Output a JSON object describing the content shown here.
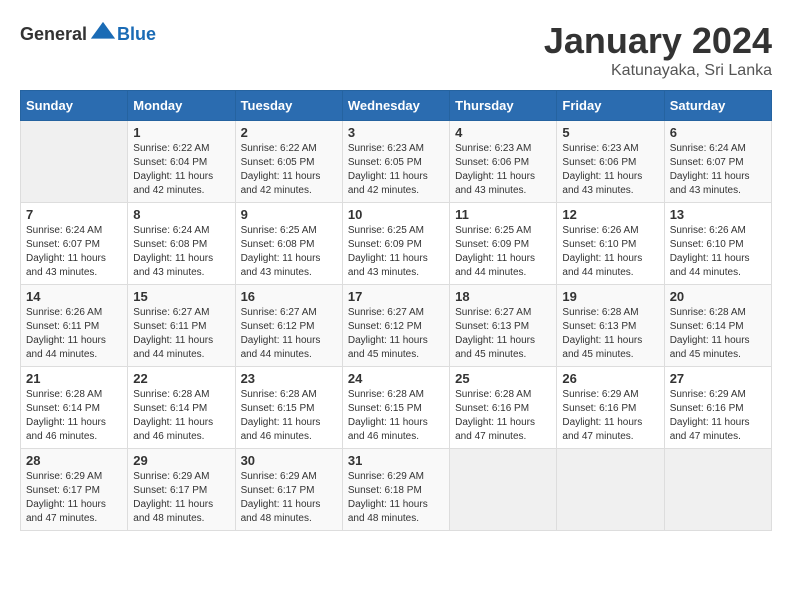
{
  "header": {
    "logo_general": "General",
    "logo_blue": "Blue",
    "title": "January 2024",
    "subtitle": "Katunayaka, Sri Lanka"
  },
  "calendar": {
    "days_of_week": [
      "Sunday",
      "Monday",
      "Tuesday",
      "Wednesday",
      "Thursday",
      "Friday",
      "Saturday"
    ],
    "weeks": [
      [
        {
          "day": "",
          "info": ""
        },
        {
          "day": "1",
          "info": "Sunrise: 6:22 AM\nSunset: 6:04 PM\nDaylight: 11 hours and 42 minutes."
        },
        {
          "day": "2",
          "info": "Sunrise: 6:22 AM\nSunset: 6:05 PM\nDaylight: 11 hours and 42 minutes."
        },
        {
          "day": "3",
          "info": "Sunrise: 6:23 AM\nSunset: 6:05 PM\nDaylight: 11 hours and 42 minutes."
        },
        {
          "day": "4",
          "info": "Sunrise: 6:23 AM\nSunset: 6:06 PM\nDaylight: 11 hours and 43 minutes."
        },
        {
          "day": "5",
          "info": "Sunrise: 6:23 AM\nSunset: 6:06 PM\nDaylight: 11 hours and 43 minutes."
        },
        {
          "day": "6",
          "info": "Sunrise: 6:24 AM\nSunset: 6:07 PM\nDaylight: 11 hours and 43 minutes."
        }
      ],
      [
        {
          "day": "7",
          "info": "Sunrise: 6:24 AM\nSunset: 6:07 PM\nDaylight: 11 hours and 43 minutes."
        },
        {
          "day": "8",
          "info": "Sunrise: 6:24 AM\nSunset: 6:08 PM\nDaylight: 11 hours and 43 minutes."
        },
        {
          "day": "9",
          "info": "Sunrise: 6:25 AM\nSunset: 6:08 PM\nDaylight: 11 hours and 43 minutes."
        },
        {
          "day": "10",
          "info": "Sunrise: 6:25 AM\nSunset: 6:09 PM\nDaylight: 11 hours and 43 minutes."
        },
        {
          "day": "11",
          "info": "Sunrise: 6:25 AM\nSunset: 6:09 PM\nDaylight: 11 hours and 44 minutes."
        },
        {
          "day": "12",
          "info": "Sunrise: 6:26 AM\nSunset: 6:10 PM\nDaylight: 11 hours and 44 minutes."
        },
        {
          "day": "13",
          "info": "Sunrise: 6:26 AM\nSunset: 6:10 PM\nDaylight: 11 hours and 44 minutes."
        }
      ],
      [
        {
          "day": "14",
          "info": "Sunrise: 6:26 AM\nSunset: 6:11 PM\nDaylight: 11 hours and 44 minutes."
        },
        {
          "day": "15",
          "info": "Sunrise: 6:27 AM\nSunset: 6:11 PM\nDaylight: 11 hours and 44 minutes."
        },
        {
          "day": "16",
          "info": "Sunrise: 6:27 AM\nSunset: 6:12 PM\nDaylight: 11 hours and 44 minutes."
        },
        {
          "day": "17",
          "info": "Sunrise: 6:27 AM\nSunset: 6:12 PM\nDaylight: 11 hours and 45 minutes."
        },
        {
          "day": "18",
          "info": "Sunrise: 6:27 AM\nSunset: 6:13 PM\nDaylight: 11 hours and 45 minutes."
        },
        {
          "day": "19",
          "info": "Sunrise: 6:28 AM\nSunset: 6:13 PM\nDaylight: 11 hours and 45 minutes."
        },
        {
          "day": "20",
          "info": "Sunrise: 6:28 AM\nSunset: 6:14 PM\nDaylight: 11 hours and 45 minutes."
        }
      ],
      [
        {
          "day": "21",
          "info": "Sunrise: 6:28 AM\nSunset: 6:14 PM\nDaylight: 11 hours and 46 minutes."
        },
        {
          "day": "22",
          "info": "Sunrise: 6:28 AM\nSunset: 6:14 PM\nDaylight: 11 hours and 46 minutes."
        },
        {
          "day": "23",
          "info": "Sunrise: 6:28 AM\nSunset: 6:15 PM\nDaylight: 11 hours and 46 minutes."
        },
        {
          "day": "24",
          "info": "Sunrise: 6:28 AM\nSunset: 6:15 PM\nDaylight: 11 hours and 46 minutes."
        },
        {
          "day": "25",
          "info": "Sunrise: 6:28 AM\nSunset: 6:16 PM\nDaylight: 11 hours and 47 minutes."
        },
        {
          "day": "26",
          "info": "Sunrise: 6:29 AM\nSunset: 6:16 PM\nDaylight: 11 hours and 47 minutes."
        },
        {
          "day": "27",
          "info": "Sunrise: 6:29 AM\nSunset: 6:16 PM\nDaylight: 11 hours and 47 minutes."
        }
      ],
      [
        {
          "day": "28",
          "info": "Sunrise: 6:29 AM\nSunset: 6:17 PM\nDaylight: 11 hours and 47 minutes."
        },
        {
          "day": "29",
          "info": "Sunrise: 6:29 AM\nSunset: 6:17 PM\nDaylight: 11 hours and 48 minutes."
        },
        {
          "day": "30",
          "info": "Sunrise: 6:29 AM\nSunset: 6:17 PM\nDaylight: 11 hours and 48 minutes."
        },
        {
          "day": "31",
          "info": "Sunrise: 6:29 AM\nSunset: 6:18 PM\nDaylight: 11 hours and 48 minutes."
        },
        {
          "day": "",
          "info": ""
        },
        {
          "day": "",
          "info": ""
        },
        {
          "day": "",
          "info": ""
        }
      ]
    ]
  }
}
